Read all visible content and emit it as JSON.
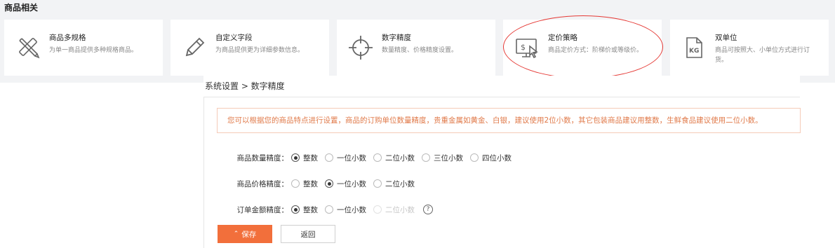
{
  "section": {
    "title": "商品相关"
  },
  "cards": [
    {
      "title": "商品多规格",
      "desc": "为单一商品提供多种规格商品。",
      "icon": "tools-icon"
    },
    {
      "title": "自定义字段",
      "desc": "为商品提供更为详细参数信息。",
      "icon": "pencil-icon"
    },
    {
      "title": "数字精度",
      "desc": "数量精度、价格精度设置。",
      "icon": "crosshair-icon"
    },
    {
      "title": "定价策略",
      "desc": "商品定价方式：阶梯价或等级价。",
      "icon": "pricing-monitor-icon"
    },
    {
      "title": "双单位",
      "desc": "商品可按照大、小单位方式进行订货。",
      "icon": "kg-file-icon"
    }
  ],
  "breadcrumb": "系统设置 > 数字精度",
  "tip": "您可以根据您的商品特点进行设置，商品的订购单位数量精度，贵重金属如黄金、白银，建议使用2位小数，其它包装商品建议用整数，生鲜食品建议使用二位小数。",
  "settings": {
    "quantity": {
      "label": "商品数量精度：",
      "options": [
        "整数",
        "一位小数",
        "二位小数",
        "三位小数",
        "四位小数"
      ],
      "selected": "整数"
    },
    "price": {
      "label": "商品价格精度：",
      "options": [
        "整数",
        "一位小数",
        "二位小数"
      ],
      "selected": "一位小数"
    },
    "amount": {
      "label": "订单金额精度：",
      "options": [
        "整数",
        "一位小数",
        "二位小数"
      ],
      "selected": "整数",
      "help": "?"
    }
  },
  "buttons": {
    "save": "保存",
    "back": "返回"
  },
  "colors": {
    "accent": "#f26f3b",
    "tip_text": "#e07a4a",
    "highlight": "#e53935"
  }
}
